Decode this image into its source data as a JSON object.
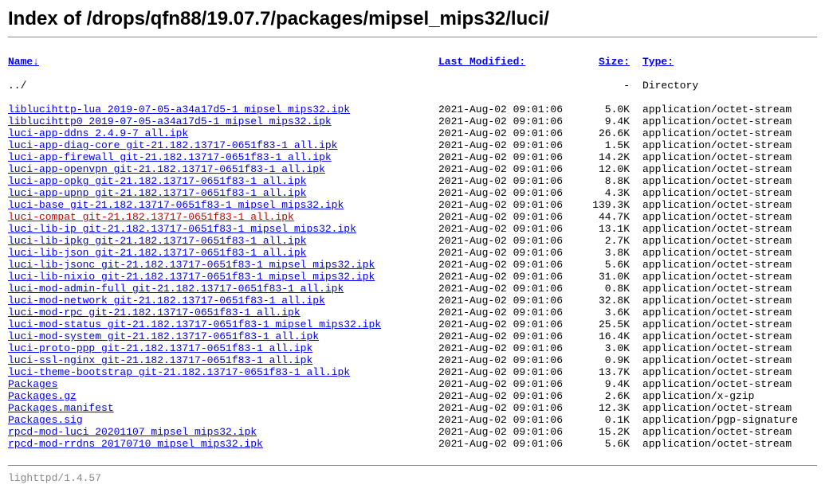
{
  "title": "Index of /drops/qfn88/19.07.7/packages/mipsel_mips32/luci/",
  "headers": {
    "name": "Name↓",
    "modified": "Last Modified:",
    "size": "Size:",
    "type": "Type:"
  },
  "parent": {
    "name": "../",
    "size": "-",
    "type": "Directory"
  },
  "files": [
    {
      "name": "liblucihttp-lua_2019-07-05-a34a17d5-1_mipsel_mips32.ipk",
      "modified": "2021-Aug-02 09:01:06",
      "size": "5.0K",
      "type": "application/octet-stream"
    },
    {
      "name": "liblucihttp0_2019-07-05-a34a17d5-1_mipsel_mips32.ipk",
      "modified": "2021-Aug-02 09:01:06",
      "size": "9.4K",
      "type": "application/octet-stream"
    },
    {
      "name": "luci-app-ddns_2.4.9-7_all.ipk",
      "modified": "2021-Aug-02 09:01:06",
      "size": "26.6K",
      "type": "application/octet-stream"
    },
    {
      "name": "luci-app-diag-core_git-21.182.13717-0651f83-1_all.ipk",
      "modified": "2021-Aug-02 09:01:06",
      "size": "1.5K",
      "type": "application/octet-stream"
    },
    {
      "name": "luci-app-firewall_git-21.182.13717-0651f83-1_all.ipk",
      "modified": "2021-Aug-02 09:01:06",
      "size": "14.2K",
      "type": "application/octet-stream"
    },
    {
      "name": "luci-app-openvpn_git-21.182.13717-0651f83-1_all.ipk",
      "modified": "2021-Aug-02 09:01:06",
      "size": "12.0K",
      "type": "application/octet-stream"
    },
    {
      "name": "luci-app-opkg_git-21.182.13717-0651f83-1_all.ipk",
      "modified": "2021-Aug-02 09:01:06",
      "size": "8.8K",
      "type": "application/octet-stream"
    },
    {
      "name": "luci-app-upnp_git-21.182.13717-0651f83-1_all.ipk",
      "modified": "2021-Aug-02 09:01:06",
      "size": "4.3K",
      "type": "application/octet-stream"
    },
    {
      "name": "luci-base_git-21.182.13717-0651f83-1_mipsel_mips32.ipk",
      "modified": "2021-Aug-02 09:01:06",
      "size": "139.3K",
      "type": "application/octet-stream"
    },
    {
      "name": "luci-compat_git-21.182.13717-0651f83-1_all.ipk",
      "modified": "2021-Aug-02 09:01:06",
      "size": "44.7K",
      "type": "application/octet-stream",
      "hovered": true
    },
    {
      "name": "luci-lib-ip_git-21.182.13717-0651f83-1_mipsel_mips32.ipk",
      "modified": "2021-Aug-02 09:01:06",
      "size": "13.1K",
      "type": "application/octet-stream"
    },
    {
      "name": "luci-lib-ipkg_git-21.182.13717-0651f83-1_all.ipk",
      "modified": "2021-Aug-02 09:01:06",
      "size": "2.7K",
      "type": "application/octet-stream"
    },
    {
      "name": "luci-lib-json_git-21.182.13717-0651f83-1_all.ipk",
      "modified": "2021-Aug-02 09:01:06",
      "size": "3.8K",
      "type": "application/octet-stream"
    },
    {
      "name": "luci-lib-jsonc_git-21.182.13717-0651f83-1_mipsel_mips32.ipk",
      "modified": "2021-Aug-02 09:01:06",
      "size": "5.6K",
      "type": "application/octet-stream"
    },
    {
      "name": "luci-lib-nixio_git-21.182.13717-0651f83-1_mipsel_mips32.ipk",
      "modified": "2021-Aug-02 09:01:06",
      "size": "31.0K",
      "type": "application/octet-stream"
    },
    {
      "name": "luci-mod-admin-full_git-21.182.13717-0651f83-1_all.ipk",
      "modified": "2021-Aug-02 09:01:06",
      "size": "0.8K",
      "type": "application/octet-stream"
    },
    {
      "name": "luci-mod-network_git-21.182.13717-0651f83-1_all.ipk",
      "modified": "2021-Aug-02 09:01:06",
      "size": "32.8K",
      "type": "application/octet-stream"
    },
    {
      "name": "luci-mod-rpc_git-21.182.13717-0651f83-1_all.ipk",
      "modified": "2021-Aug-02 09:01:06",
      "size": "3.6K",
      "type": "application/octet-stream"
    },
    {
      "name": "luci-mod-status_git-21.182.13717-0651f83-1_mipsel_mips32.ipk",
      "modified": "2021-Aug-02 09:01:06",
      "size": "25.5K",
      "type": "application/octet-stream"
    },
    {
      "name": "luci-mod-system_git-21.182.13717-0651f83-1_all.ipk",
      "modified": "2021-Aug-02 09:01:06",
      "size": "16.4K",
      "type": "application/octet-stream"
    },
    {
      "name": "luci-proto-ppp_git-21.182.13717-0651f83-1_all.ipk",
      "modified": "2021-Aug-02 09:01:06",
      "size": "3.0K",
      "type": "application/octet-stream"
    },
    {
      "name": "luci-ssl-nginx_git-21.182.13717-0651f83-1_all.ipk",
      "modified": "2021-Aug-02 09:01:06",
      "size": "0.9K",
      "type": "application/octet-stream"
    },
    {
      "name": "luci-theme-bootstrap_git-21.182.13717-0651f83-1_all.ipk",
      "modified": "2021-Aug-02 09:01:06",
      "size": "13.7K",
      "type": "application/octet-stream"
    },
    {
      "name": "Packages",
      "modified": "2021-Aug-02 09:01:06",
      "size": "9.4K",
      "type": "application/octet-stream"
    },
    {
      "name": "Packages.gz",
      "modified": "2021-Aug-02 09:01:06",
      "size": "2.6K",
      "type": "application/x-gzip"
    },
    {
      "name": "Packages.manifest",
      "modified": "2021-Aug-02 09:01:06",
      "size": "12.3K",
      "type": "application/octet-stream"
    },
    {
      "name": "Packages.sig",
      "modified": "2021-Aug-02 09:01:06",
      "size": "0.1K",
      "type": "application/pgp-signature"
    },
    {
      "name": "rpcd-mod-luci_20201107_mipsel_mips32.ipk",
      "modified": "2021-Aug-02 09:01:06",
      "size": "15.2K",
      "type": "application/octet-stream"
    },
    {
      "name": "rpcd-mod-rrdns_20170710_mipsel_mips32.ipk",
      "modified": "2021-Aug-02 09:01:06",
      "size": "5.6K",
      "type": "application/octet-stream"
    }
  ],
  "footer": "lighttpd/1.4.57"
}
